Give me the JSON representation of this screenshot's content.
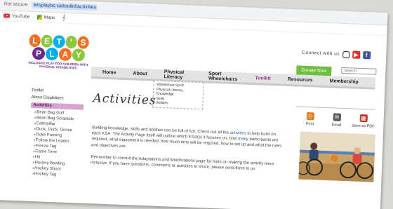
{
  "browser": {
    "security": "Not secure",
    "url": "letsplaybc.ca/toolkit/activities"
  },
  "bookmarks": [
    {
      "label": "YouTube"
    },
    {
      "label": "Maps"
    }
  ],
  "logo": {
    "line1": [
      "L",
      "E",
      "T",
      "'",
      "S"
    ],
    "line2": [
      "P",
      "L",
      "A",
      "Y"
    ],
    "tagline": "INCLUSIVE PLAY FOR CHILDREN WITH PHYSICAL DISABILITIES",
    "colors": [
      "#f37021",
      "#8dc63f",
      "#00aeef",
      "#8dc63f",
      "#f37021",
      "#6a2c8a",
      "#00aeef",
      "#f37021",
      "#8dc63f"
    ]
  },
  "header": {
    "connect": "Connect with us",
    "social": [
      {
        "icon": "instagram-icon",
        "color": "#222222"
      },
      {
        "icon": "youtube-icon",
        "color": "#e52d27"
      },
      {
        "icon": "facebook-icon",
        "color": "#3b5998"
      }
    ],
    "donate": "Donate Now",
    "search_placeholder": "Search"
  },
  "nav": [
    "Home",
    "About",
    "Physical Literacy",
    "Sport Wheelchairs",
    "Toolkit",
    "Resources",
    "Membership"
  ],
  "nav_active": "Toolkit",
  "dropdown": [
    "Wheelchair Sport",
    "Physical Literacy",
    "Knowledge",
    "Skills",
    "Abilities"
  ],
  "sidebar": {
    "toolkit": "Toolkit",
    "about": "About Disabilities",
    "active": "Activities",
    "items": [
      "Bean Bag Golf",
      "Bean Bag Scramble",
      "Caterpillar",
      "Duck, Duck, Goose",
      "Duke Passing",
      "Follow the Leader",
      "Freeze Tag",
      "Game Time",
      "Hit",
      "Hockey Bowling",
      "Hockey Shoot",
      "Hockey Tag"
    ]
  },
  "main": {
    "title": "Activities",
    "p1_before": "Building knowledge, skills and abilities can be full of fun. Check out all the ",
    "p1_link": "activities",
    "p1_after": " to help build on each KSA. The Activity Page itself will outline which KSA(s) it focuses on, how many participants are required, what equipment is needed, how much time will be required, how to set up and what the rules and objectives are.",
    "p2": "Remember to consult the Adaptations and Modifications page for hints on making the activity more inclusive. If you have questions, comments or activities to share, please send them to us."
  },
  "tools": [
    {
      "label": "Print",
      "icon": "print-icon",
      "color": "#e07b1a"
    },
    {
      "label": "Email",
      "icon": "email-icon",
      "color": "#555555"
    },
    {
      "label": "Save as PDF",
      "icon": "pdf-icon",
      "color": "#c0392b"
    }
  ]
}
